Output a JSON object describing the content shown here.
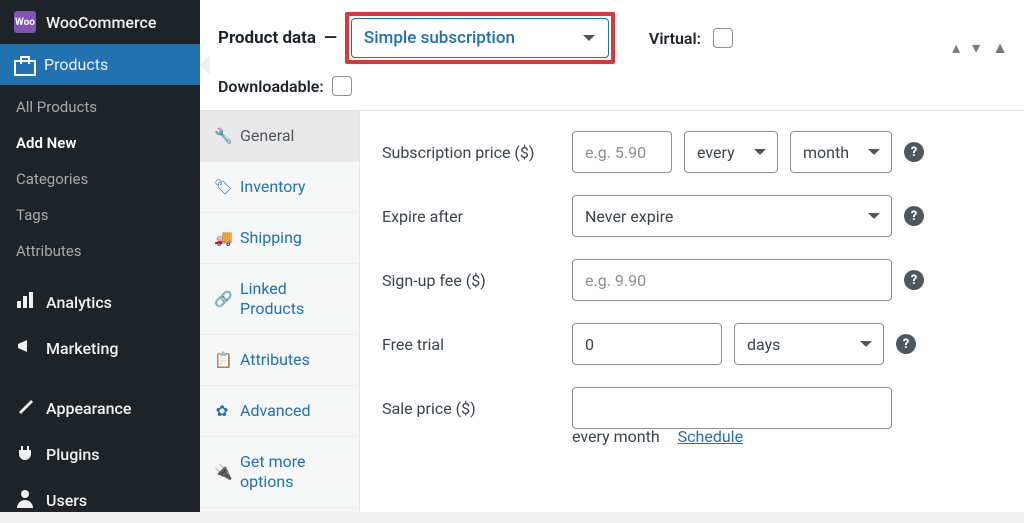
{
  "sidebar": {
    "woocommerce": "WooCommerce",
    "products": "Products",
    "submenu": [
      "All Products",
      "Add New",
      "Categories",
      "Tags",
      "Attributes"
    ],
    "active_sub": 1,
    "analytics": "Analytics",
    "marketing": "Marketing",
    "appearance": "Appearance",
    "plugins": "Plugins",
    "users": "Users"
  },
  "panel": {
    "title": "Product data",
    "dash": "—",
    "type": "Simple subscription",
    "virtual_label": "Virtual:",
    "downloadable_label": "Downloadable:"
  },
  "tabs": {
    "general": "General",
    "inventory": "Inventory",
    "shipping": "Shipping",
    "linked": "Linked Products",
    "attributes": "Attributes",
    "advanced": "Advanced",
    "more": "Get more options"
  },
  "fields": {
    "sub_price_label": "Subscription price ($)",
    "sub_price_placeholder": "e.g. 5.90",
    "every": "every",
    "period": "month",
    "expire_label": "Expire after",
    "expire_value": "Never expire",
    "signup_label": "Sign-up fee ($)",
    "signup_placeholder": "e.g. 9.90",
    "trial_label": "Free trial",
    "trial_value": "0",
    "trial_unit": "days",
    "sale_label": "Sale price ($)",
    "sale_note": "every month",
    "schedule": "Schedule"
  },
  "help": "?"
}
